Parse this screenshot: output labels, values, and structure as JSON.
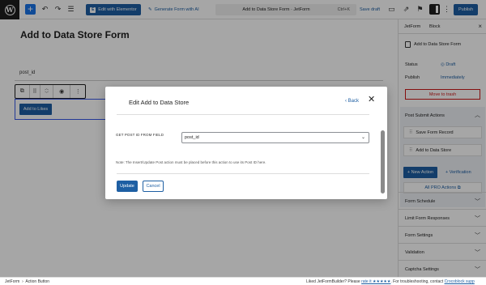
{
  "toolbar": {
    "elementor_label": "Edit with Elementor",
    "generate_label": "Generate Form with AI",
    "doc_title": "Add to Data Store Form · JetForm",
    "shortcut": "Ctrl+K",
    "save_draft": "Save draft",
    "publish": "Publish"
  },
  "editor": {
    "page_title": "Add to Data Store Form",
    "field_label": "post_id",
    "button_label": "Add to Likes"
  },
  "sidebar": {
    "tab_jetform": "JetForm",
    "tab_block": "Block",
    "form_name": "Add to Data Store Form",
    "status_label": "Status",
    "status_value": "Draft",
    "publish_label": "Publish",
    "publish_value": "Immediately",
    "trash_label": "Move to trash",
    "psa_title": "Post Submit Actions",
    "actions": [
      "Save Form Record",
      "Add to Data Store"
    ],
    "new_action": "+ New Action",
    "verification": "+ Verification",
    "pro_actions": "All PRO Actions",
    "sections": [
      "Form Schedule",
      "Limit Form Responses",
      "Form Settings",
      "Validation",
      "Captcha Settings"
    ]
  },
  "modal": {
    "title": "Edit Add to Data Store",
    "back": "Back",
    "field_label": "GET POST ID FROM FIELD",
    "select_value": "post_id",
    "note": "Note: The Insert/Update Post action must be placed before this action to use its Post ID here.",
    "update": "Update",
    "cancel": "Cancel"
  },
  "statusbar": {
    "crumb_root": "JetForm",
    "crumb_sep": "›",
    "crumb_leaf": "Action Button",
    "footer_text_1": "Liked JetFormBuilder? Please",
    "footer_link_1": "rate it ★★★★★",
    "footer_text_2": ". For troubleshooting, contact",
    "footer_link_2": "Crocoblock supp"
  },
  "colors": {
    "accent": "#1e5fa3",
    "danger": "#cc1818",
    "overlay": "rgba(0,0,0,0.35)"
  }
}
